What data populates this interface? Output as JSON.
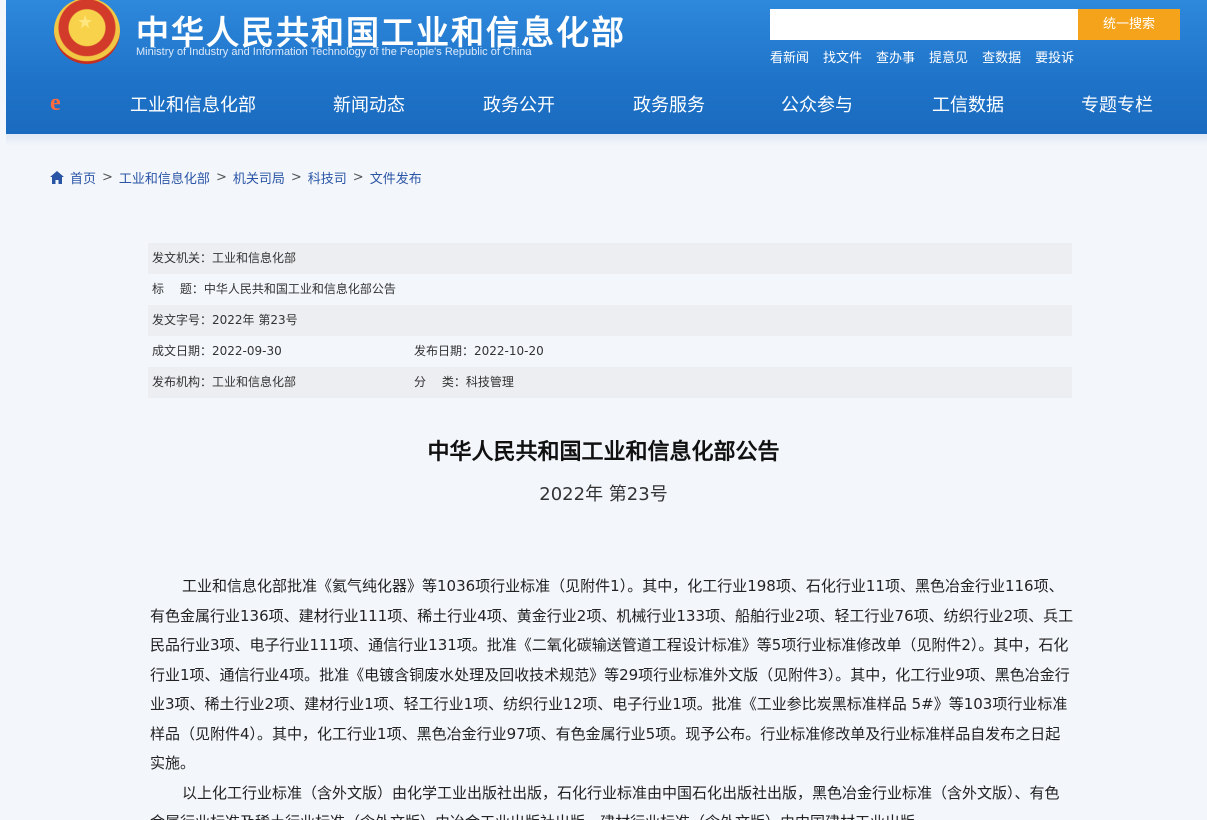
{
  "header": {
    "title": "中华人民共和国工业和信息化部",
    "subtitle": "Ministry of Industry and Information Technology of the People's Republic of China",
    "search_placeholder": "",
    "search_button": "统一搜索",
    "quick_links": [
      "看新闻",
      "找文件",
      "查办事",
      "提意见",
      "查数据",
      "要投诉"
    ]
  },
  "nav": {
    "items": [
      "工业和信息化部",
      "新闻动态",
      "政务公开",
      "政务服务",
      "公众参与",
      "工信数据",
      "专题专栏"
    ]
  },
  "breadcrumb": {
    "items": [
      "首页",
      "工业和信息化部",
      "机关司局",
      "科技司",
      "文件发布"
    ],
    "separator": ">"
  },
  "info": {
    "issuer": "发文机关：工业和信息化部",
    "title": "标　 题：中华人民共和国工业和信息化部公告",
    "doc_number": "发文字号：2022年 第23号",
    "written_date": "成文日期：2022-09-30",
    "publish_date": "发布日期：2022-10-20",
    "publisher": "发布机构：工业和信息化部",
    "category": "分　 类：科技管理"
  },
  "document": {
    "title": "中华人民共和国工业和信息化部公告",
    "number": "2022年 第23号",
    "paragraphs": [
      "工业和信息化部批准《氦气纯化器》等1036项行业标准（见附件1）。其中，化工行业198项、石化行业11项、黑色冶金行业116项、有色金属行业136项、建材行业111项、稀土行业4项、黄金行业2项、机械行业133项、船舶行业2项、轻工行业76项、纺织行业2项、兵工民品行业3项、电子行业111项、通信行业131项。批准《二氧化碳输送管道工程设计标准》等5项行业标准修改单（见附件2）。其中，石化行业1项、通信行业4项。批准《电镀含铜废水处理及回收技术规范》等29项行业标准外文版（见附件3）。其中，化工行业9项、黑色冶金行业3项、稀土行业2项、建材行业1项、轻工行业1项、纺织行业12项、电子行业1项。批准《工业参比炭黑标准样品 5#》等103项行业标准样品（见附件4）。其中，化工行业1项、黑色冶金行业97项、有色金属行业5项。现予公布。行业标准修改单及行业标准样品自发布之日起实施。",
      "以上化工行业标准（含外文版）由化学工业出版社出版，石化行业标准由中国石化出版社出版，黑色冶金行业标准（含外文版）、有色金属行业标准及稀土行业标准（含外文版）由冶金工业出版社出版，建材行业标准（含外文版）由中国建材工业出版"
    ]
  },
  "colors": {
    "header_blue": "#1e73c8",
    "search_orange": "#f5a31a",
    "link_blue": "#2a55a6"
  }
}
